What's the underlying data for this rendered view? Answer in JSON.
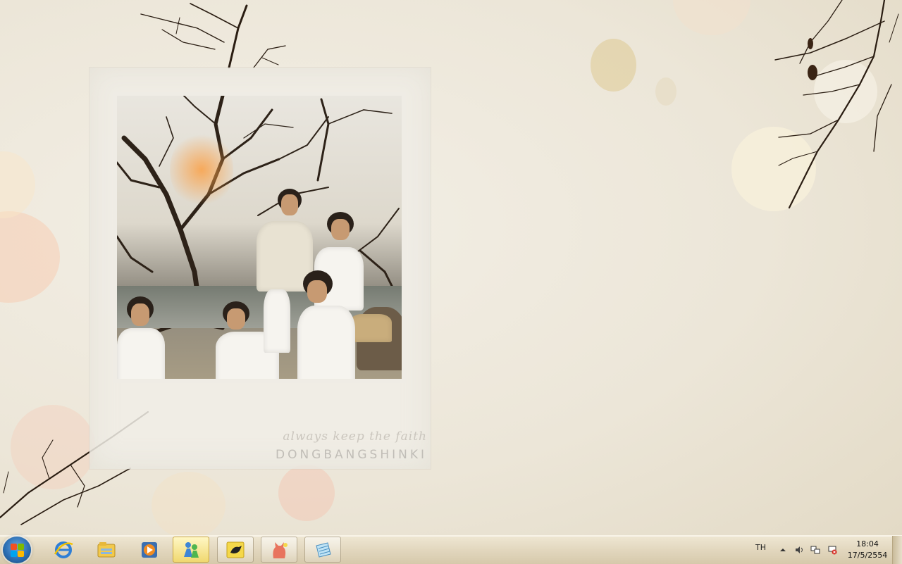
{
  "wallpaper": {
    "caption": "always keep the faith",
    "brand": "DONGBANGSHINKI"
  },
  "taskbar": {
    "start_label": "Start",
    "pinned": [
      {
        "name": "internet-explorer-icon"
      },
      {
        "name": "windows-explorer-icon"
      },
      {
        "name": "media-player-icon"
      },
      {
        "name": "messenger-icon"
      },
      {
        "name": "bird-app-icon"
      },
      {
        "name": "cat-app-icon"
      },
      {
        "name": "notepad-icon"
      }
    ],
    "language": "TH",
    "time": "18:04",
    "date": "17/5/2554"
  },
  "colors": {
    "taskbar": "#e2d7be",
    "accent": "#2c6fb4",
    "active_button": "#f0d870"
  }
}
